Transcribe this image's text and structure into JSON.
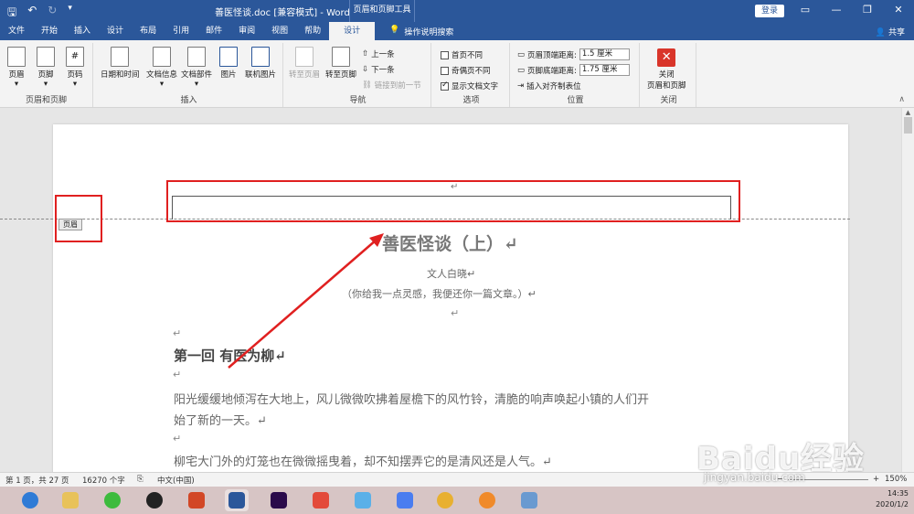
{
  "titlebar": {
    "title": "善医怪谈.doc [兼容模式] - Word",
    "context_tab": "页眉和页脚工具",
    "login": "登录"
  },
  "tabs": {
    "items": [
      "文件",
      "开始",
      "插入",
      "设计",
      "布局",
      "引用",
      "邮件",
      "审阅",
      "视图",
      "帮助"
    ],
    "active": "设计",
    "search": "操作说明搜索",
    "share": "共享"
  },
  "ribbon": {
    "group_header_footer": {
      "name": "页眉和页脚",
      "header": "页眉",
      "footer": "页脚",
      "page_number": "页码"
    },
    "group_insert": {
      "name": "插入",
      "datetime": "日期和时间",
      "docinfo": "文档信息",
      "docparts": "文档部件",
      "picture": "图片",
      "online_picture": "联机图片"
    },
    "group_nav": {
      "name": "导航",
      "goto_header": "转至页眉",
      "goto_footer": "转至页脚",
      "prev": "上一条",
      "next": "下一条",
      "link_prev": "链接到前一节"
    },
    "group_options": {
      "name": "选项",
      "diff_first": "首页不同",
      "diff_odd_even": "奇偶页不同",
      "show_text": "显示文档文字",
      "show_text_checked": true
    },
    "group_position": {
      "name": "位置",
      "header_top_label": "页眉顶端距离:",
      "header_top_value": "1.5 厘米",
      "footer_bottom_label": "页脚底端距离:",
      "footer_bottom_value": "1.75 厘米",
      "insert_align_tab": "插入对齐制表位"
    },
    "group_close": {
      "name": "关闭",
      "close_label_1": "关闭",
      "close_label_2": "页眉和页脚"
    }
  },
  "document": {
    "header_tag": "页眉",
    "title": "善医怪谈（上）↵",
    "author": "文人白晓↵",
    "subtitle": "（你给我一点灵感，我便还你一篇文章。）↵",
    "para_mark": "↵",
    "chapter": "第一回  有医为柳↵",
    "p1_line1": "阳光缓缓地倾泻在大地上，风儿微微吹拂着屋檐下的风竹铃，清脆的响声唤起小镇的人们开",
    "p1_line2": "始了新的一天。↵",
    "p2": "柳宅大门外的灯笼也在微微摇曳着，却不知摆弄它的是清风还是人气。↵"
  },
  "status": {
    "page": "第 1 页，共 27 页",
    "words": "16270 个字",
    "lang": "中文(中国)",
    "zoom": "150%"
  },
  "taskbar": {
    "time": "14:35",
    "date": "2020/1/2"
  },
  "watermark": {
    "brand": "Baidu经验",
    "url": "jingyan.baidu.com"
  },
  "colors": {
    "accent": "#2b579a",
    "annotation": "#e02020",
    "close_red": "#d9352a"
  }
}
